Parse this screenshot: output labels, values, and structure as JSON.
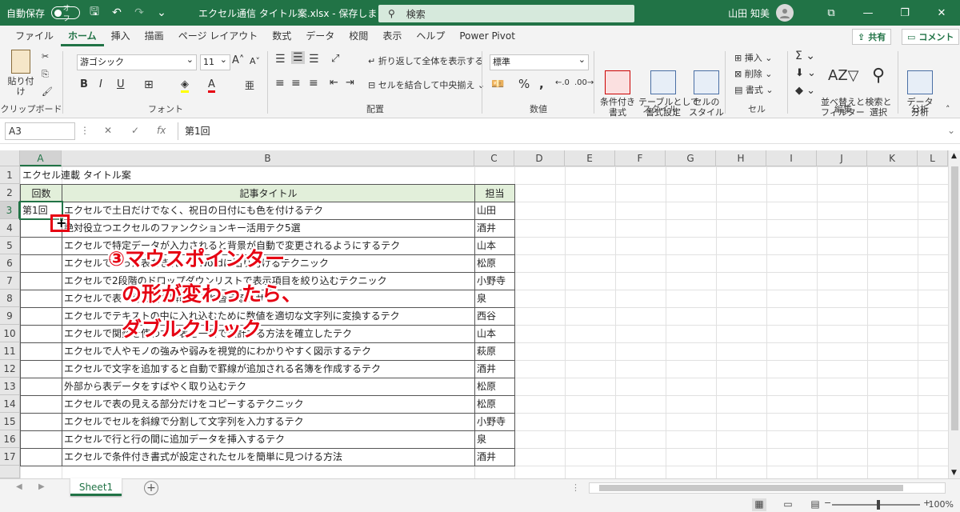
{
  "titlebar": {
    "autosave_label": "自動保存",
    "autosave_state": "オフ",
    "doc_title": "エクセル通信 タイトル案.xlsx  -  保存しました",
    "search_placeholder": "検索",
    "user_name": "山田 知美"
  },
  "menu": {
    "tabs": [
      "ファイル",
      "ホーム",
      "挿入",
      "描画",
      "ページ レイアウト",
      "数式",
      "データ",
      "校閲",
      "表示",
      "ヘルプ",
      "Power Pivot"
    ],
    "active": "ホーム",
    "share": "共有",
    "comment": "コメント"
  },
  "ribbon": {
    "clipboard": {
      "paste": "貼り付け",
      "label": "クリップボード"
    },
    "font": {
      "name": "游ゴシック",
      "size": "11",
      "label": "フォント",
      "bold": "B",
      "italic": "I",
      "underline": "U"
    },
    "alignment": {
      "wrap": "折り返して全体を表示する",
      "merge": "セルを結合して中央揃え",
      "label": "配置"
    },
    "number": {
      "format": "標準",
      "percent": "%",
      "label": "数値"
    },
    "styles": {
      "cond": "条件付き\n書式",
      "table": "テーブルとして\n書式設定",
      "cell": "セルの\nスタイル",
      "label": "スタイル"
    },
    "cells": {
      "insert": "挿入",
      "delete": "削除",
      "format": "書式",
      "label": "セル"
    },
    "editing": {
      "sort": "並べ替えと\nフィルター",
      "find": "検索と\n選択",
      "label": "編集"
    },
    "analysis": {
      "data": "データ\n分析",
      "label": "分析"
    }
  },
  "formula_bar": {
    "name_box": "A3",
    "cancel": "✕",
    "confirm": "✓",
    "fx": "fx",
    "value": "第1回"
  },
  "sheet": {
    "columns": [
      "A",
      "B",
      "C",
      "D",
      "E",
      "F",
      "G",
      "H",
      "I",
      "J",
      "K",
      "L"
    ],
    "rows": [
      "1",
      "2",
      "3",
      "4",
      "5",
      "6",
      "7",
      "8",
      "9",
      "10",
      "11",
      "12",
      "13",
      "14",
      "15",
      "16",
      "17"
    ],
    "title": "エクセル連載 タイトル案",
    "header": {
      "col_a": "回数",
      "col_b": "記事タイトル",
      "col_c": "担当"
    },
    "a3": "第1回",
    "titles": [
      "エクセルで土日だけでなく、祝日の日付にも色を付けるテク",
      "絶対役立つエクセルのファンクションキー活用テク5選",
      "エクセルで特定データが入力されると背景が自動で変更されるようにするテク",
      "エクセルで作った表をきれいにWordに貼り付けるテクニック",
      "エクセルで2段階のドロップダウンリストで表示項目を絞り込むテクニック",
      "エクセルで表の行と列を瞬時に入れ替えるワザ",
      "エクセルでテキストの中に入れ込むために数値を適切な文字列に変換するテク",
      "エクセルで関数を使わずに表を一瞬で集計する方法を確立したテク",
      "エクセルで人やモノの強みや弱みを視覚的にわかりやすく図示するテク",
      "エクセルで文字を追加すると自動で罫線が追加される名簿を作成するテク",
      "外部から表データをすばやく取り込むテク",
      "エクセルで表の見える部分だけをコピーするテクニック",
      "エクセルでセルを斜線で分割して文字列を入力するテク",
      "エクセルで行と行の間に追加データを挿入するテク",
      "エクセルで条件付き書式が設定されたセルを簡単に見つける方法"
    ],
    "owners": [
      "山田",
      "酒井",
      "山本",
      "松原",
      "小野寺",
      "泉",
      "西谷",
      "山本",
      "萩原",
      "酒井",
      "松原",
      "松原",
      "小野寺",
      "泉",
      "酒井"
    ]
  },
  "annotation": {
    "line1": "③マウスポインター",
    "line2": "の形が変わったら、",
    "line3": "ダブルクリック",
    "color": "#e60012"
  },
  "tabs": {
    "sheet1": "Sheet1",
    "add": "+"
  },
  "status": {
    "zoom": "100%"
  }
}
